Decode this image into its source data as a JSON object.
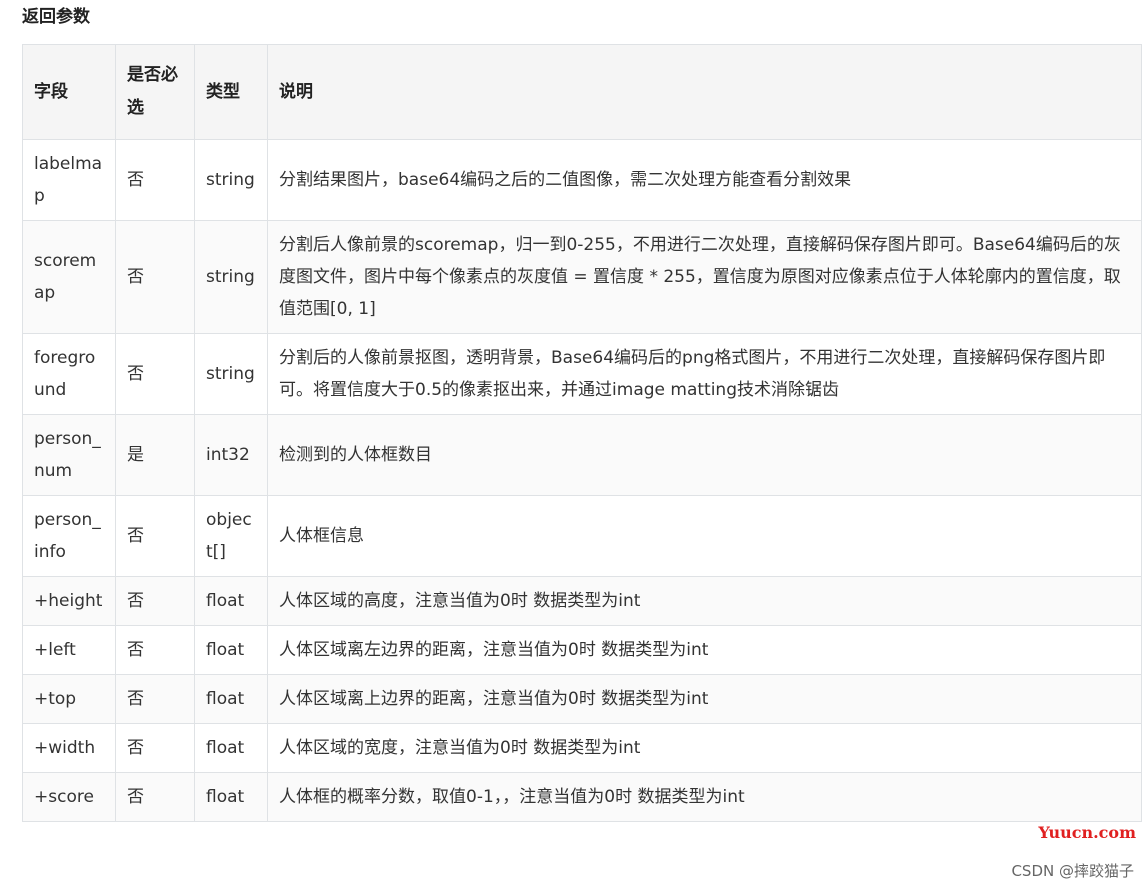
{
  "section": {
    "title": "返回参数"
  },
  "table": {
    "headers": {
      "field": "字段",
      "required": "是否必选",
      "type": "类型",
      "description": "说明"
    },
    "rows": [
      {
        "field": "labelmap",
        "required": "否",
        "type": "string",
        "description": "分割结果图片，base64编码之后的二值图像，需二次处理方能查看分割效果"
      },
      {
        "field": "scoremap",
        "required": "否",
        "type": "string",
        "description": "分割后人像前景的scoremap，归一到0-255，不用进行二次处理，直接解码保存图片即可。Base64编码后的灰度图文件，图片中每个像素点的灰度值 = 置信度 * 255，置信度为原图对应像素点位于人体轮廓内的置信度，取值范围[0, 1]"
      },
      {
        "field": "foreground",
        "required": "否",
        "type": "string",
        "description": "分割后的人像前景抠图，透明背景，Base64编码后的png格式图片，不用进行二次处理，直接解码保存图片即可。将置信度大于0.5的像素抠出来，并通过image matting技术消除锯齿"
      },
      {
        "field": "person_num",
        "required": "是",
        "type": "int32",
        "description": "检测到的人体框数目"
      },
      {
        "field": "person_info",
        "required": "否",
        "type": "object[]",
        "description": "人体框信息"
      },
      {
        "field": "+height",
        "required": "否",
        "type": "float",
        "description": "人体区域的高度，注意当值为0时 数据类型为int"
      },
      {
        "field": "+left",
        "required": "否",
        "type": "float",
        "description": "人体区域离左边界的距离，注意当值为0时 数据类型为int"
      },
      {
        "field": "+top",
        "required": "否",
        "type": "float",
        "description": "人体区域离上边界的距离，注意当值为0时 数据类型为int"
      },
      {
        "field": "+width",
        "required": "否",
        "type": "float",
        "description": "人体区域的宽度，注意当值为0时 数据类型为int"
      },
      {
        "field": "+score",
        "required": "否",
        "type": "float",
        "description": "人体框的概率分数，取值0-1，，注意当值为0时 数据类型为int"
      }
    ]
  },
  "watermarks": {
    "site": "Yuucn.com",
    "author": "CSDN @摔跤猫子"
  }
}
